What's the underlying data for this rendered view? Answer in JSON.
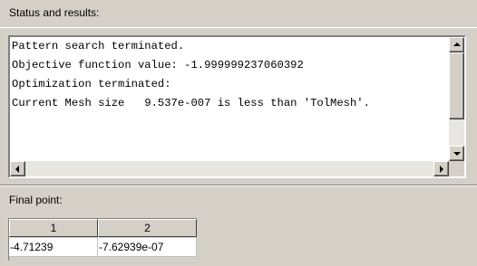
{
  "status_section": {
    "label": "Status and results:",
    "lines": [
      "Pattern search terminated.",
      "Objective function value: -1.999999237060392",
      "Optimization terminated:",
      "Current Mesh size   9.537e-007 is less than 'TolMesh'."
    ]
  },
  "final_point_section": {
    "label": "Final point:",
    "columns": [
      "1",
      "2"
    ],
    "values": [
      "-4.71239",
      "-7.62939e-07"
    ]
  },
  "icons": {
    "scroll_up": "arrow-up-icon",
    "scroll_down": "arrow-down-icon",
    "scroll_left": "arrow-left-icon",
    "scroll_right": "arrow-right-icon"
  },
  "colors": {
    "panel_bg": "#d4d0c8",
    "text_bg": "#ffffff",
    "scroll_track": "#e8e6e1"
  }
}
